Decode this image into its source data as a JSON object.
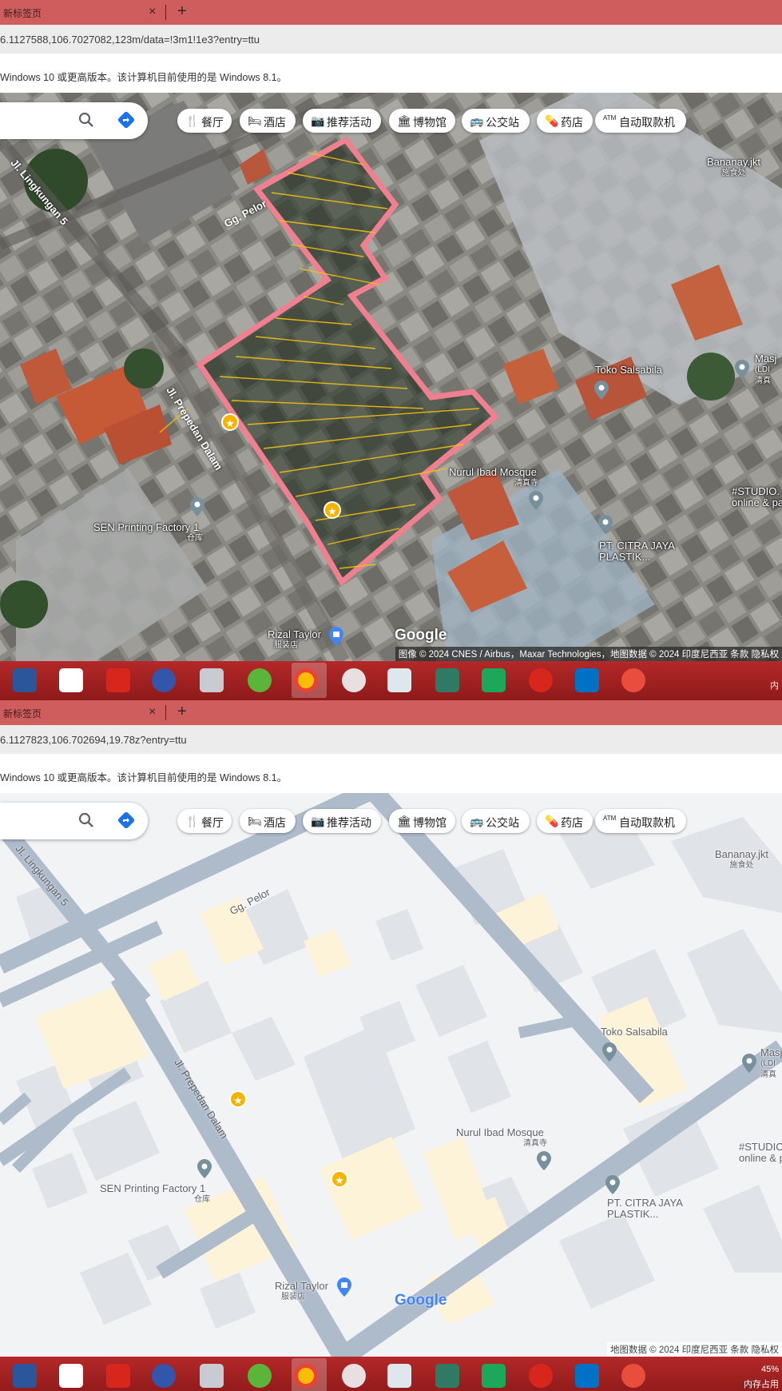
{
  "screens": [
    {
      "tab": {
        "title": "新标签页",
        "close": "×",
        "new": "+"
      },
      "address": "6.1127588,106.7027082,123m/data=!3m1!1e3?entry=ttu",
      "info": "Windows 10 或更高版本。该计算机目前使用的是 Windows 8.1。",
      "attribution": "图像 © 2024 CNES / Airbus，Maxar Technologies，地图数据 © 2024    印度尼西亚    条款    隐私权",
      "taskbar_right": "内"
    },
    {
      "tab": {
        "title": "新标签页",
        "close": "×",
        "new": "+"
      },
      "address": "6.1127823,106.702694,19.78z?entry=ttu",
      "info": "Windows 10 或更高版本。该计算机目前使用的是 Windows 8.1。",
      "attribution": "地图数据 © 2024    印度尼西亚    条款    隐私权",
      "taskbar_right": "45%",
      "taskbar_right2": "内存占用"
    }
  ],
  "chips": [
    "餐厅",
    "酒店",
    "推荐活动",
    "博物馆",
    "公交站",
    "药店",
    "自动取款机"
  ],
  "chip_icons": [
    "fork-knife-icon",
    "bed-icon",
    "camera-icon",
    "museum-icon",
    "bus-icon",
    "pharmacy-icon",
    "atm-icon"
  ],
  "places": {
    "bananay": {
      "name": "Bananay.jkt",
      "sub": "施食处"
    },
    "toko": {
      "name": "Toko Salsabila"
    },
    "masjid": {
      "name": "Masjid",
      "sub": "(LDII)",
      "sub2": "清真寺"
    },
    "masjid2": {
      "name": "Masj",
      "sub": "(LDI",
      "sub2": "清真"
    },
    "nurul": {
      "name": "Nurul Ibad Mosque",
      "sub": "清真寺"
    },
    "studio": {
      "name": "#STUDIO.",
      "sub": "online & pa"
    },
    "studio2": {
      "name": "#STUDIO",
      "sub": "online & p"
    },
    "citra": {
      "name": "PT. CITRA JAYA",
      "sub": "PLASTIK..."
    },
    "sen": {
      "name": "SEN Printing Factory 1",
      "sub": "仓库"
    },
    "rizal": {
      "name": "Rizal Taylor",
      "sub": "服装店"
    }
  },
  "roads": {
    "pelor": "Gg. Pelor",
    "lingkungan": "Jl. Lingkungan 5",
    "prepedan": "Jl. Prepedan Dalam"
  },
  "logo": "Google",
  "colors": {
    "tab_strip": "#d05d5d",
    "taskbar": "#a82222",
    "highlight": "#f08090",
    "hatch": "#f4c20d",
    "road": "#aebbcb"
  }
}
